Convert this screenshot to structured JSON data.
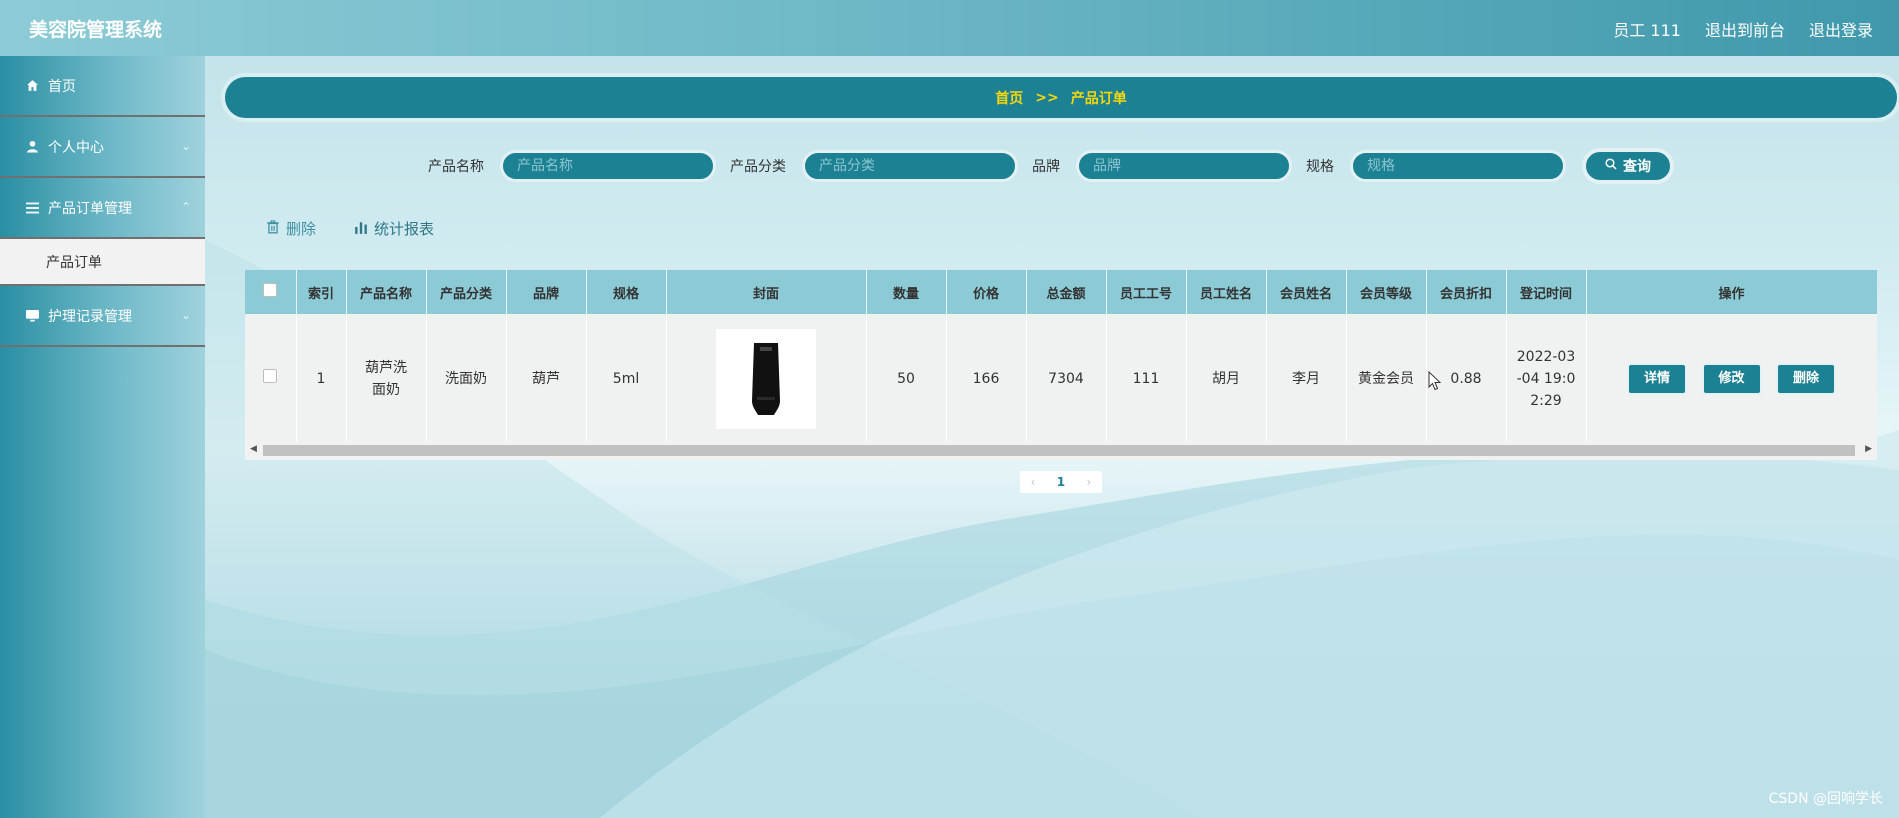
{
  "header": {
    "app_title": "美容院管理系统",
    "user_label": "员工 111",
    "to_front": "退出到前台",
    "logout": "退出登录"
  },
  "sidebar": {
    "items": [
      {
        "label": "首页",
        "icon": "home-icon"
      },
      {
        "label": "个人中心",
        "icon": "user-icon"
      },
      {
        "label": "产品订单管理",
        "icon": "menu-icon"
      },
      {
        "label": "护理记录管理",
        "icon": "monitor-icon"
      }
    ],
    "sub_item": "产品订单"
  },
  "breadcrumb": {
    "home": "首页",
    "sep": ">>",
    "current": "产品订单"
  },
  "search": {
    "fields": [
      {
        "label": "产品名称",
        "placeholder": "产品名称"
      },
      {
        "label": "产品分类",
        "placeholder": "产品分类"
      },
      {
        "label": "品牌",
        "placeholder": "品牌"
      },
      {
        "label": "规格",
        "placeholder": "规格"
      }
    ],
    "button": "查询"
  },
  "actions": {
    "delete": "删除",
    "stats": "统计报表"
  },
  "table": {
    "headers": [
      "索引",
      "产品名称",
      "产品分类",
      "品牌",
      "规格",
      "封面",
      "数量",
      "价格",
      "总金额",
      "员工工号",
      "员工姓名",
      "会员姓名",
      "会员等级",
      "会员折扣",
      "登记时间",
      "操作"
    ],
    "row": {
      "index": "1",
      "product_name": "葫芦洗面奶",
      "category": "洗面奶",
      "brand": "葫芦",
      "spec": "5ml",
      "qty": "50",
      "price": "166",
      "total": "7304",
      "emp_no": "111",
      "emp_name": "胡月",
      "member_name": "李月",
      "member_level": "黄金会员",
      "discount": "0.88",
      "time": "2022-03-04 19:02:29"
    },
    "ops": {
      "detail": "详情",
      "edit": "修改",
      "delete": "删除"
    }
  },
  "pagination": {
    "current": "1"
  },
  "watermark": "CSDN @回响学长",
  "colors": {
    "primary": "#1c8193",
    "breadcrumb_text": "#f5d90e",
    "header_row": "#8ccbd6"
  }
}
